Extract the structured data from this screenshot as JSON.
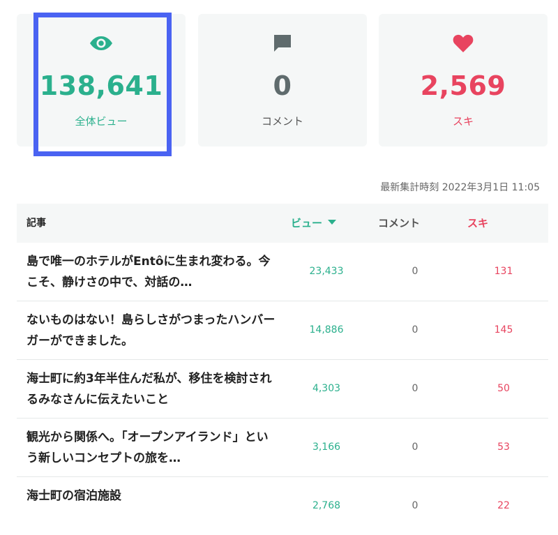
{
  "stats": {
    "views": {
      "value": "138,641",
      "label": "全体ビュー",
      "icon": "eye-icon",
      "color": "#2bb08d"
    },
    "comments": {
      "value": "0",
      "label": "コメント",
      "icon": "comment-icon",
      "color": "#5f6b6d"
    },
    "likes": {
      "value": "2,569",
      "label": "スキ",
      "icon": "heart-icon",
      "color": "#e8445f"
    }
  },
  "updated": "最新集計時刻 2022年3月1日 11:05",
  "table": {
    "headers": {
      "article": "記事",
      "views": "ビュー",
      "comments": "コメント",
      "likes": "スキ"
    },
    "rows": [
      {
        "title": "島で唯一のホテルがEntôに生まれ変わる。今こそ、静けさの中で、対話の…",
        "views": "23,433",
        "comments": "0",
        "likes": "131"
      },
      {
        "title": "ないものはない！島らしさがつまったハンバーガーができました。",
        "views": "14,886",
        "comments": "0",
        "likes": "145"
      },
      {
        "title": "海士町に約3年半住んだ私が、移住を検討されるみなさんに伝えたいこと",
        "views": "4,303",
        "comments": "0",
        "likes": "50"
      },
      {
        "title": "観光から関係へ。「オープンアイランド」という新しいコンセプトの旅を…",
        "views": "3,166",
        "comments": "0",
        "likes": "53"
      },
      {
        "title": "海士町の宿泊施設",
        "views": "2,768",
        "comments": "0",
        "likes": "22"
      }
    ]
  },
  "colors": {
    "accent_green": "#2bb08d",
    "accent_red": "#e8445f",
    "highlight": "#4a63f2",
    "card_bg": "#f5f7f7"
  }
}
